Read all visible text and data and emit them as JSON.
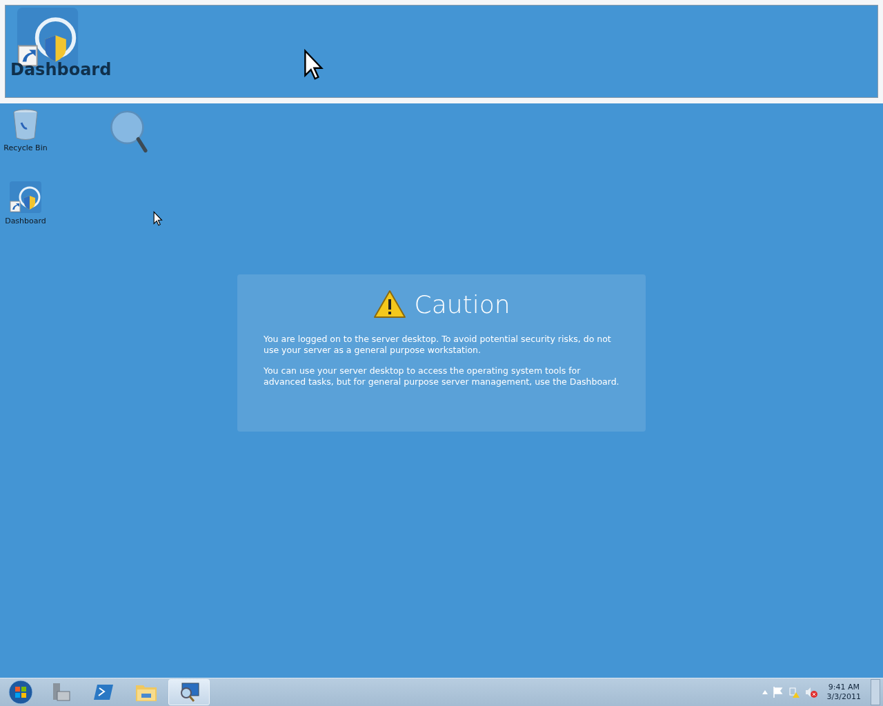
{
  "magnifier_view": {
    "icon_label": "Dashboard"
  },
  "desktop_icons": [
    {
      "kind": "recycle",
      "label": "Recycle Bin"
    },
    {
      "kind": "magnifier"
    },
    {
      "kind": "dashboard",
      "label": "Dashboard"
    }
  ],
  "caution": {
    "title": "Caution",
    "paragraphs": [
      "You are logged on to the server desktop. To avoid potential security risks, do not use your server as a general purpose workstation.",
      "You can use your server desktop to access the operating system tools for advanced tasks, but for general purpose server management, use the Dashboard."
    ]
  },
  "taskbar": {
    "items": [
      {
        "kind": "server-manager",
        "selected": false
      },
      {
        "kind": "powershell",
        "selected": false
      },
      {
        "kind": "explorer",
        "selected": false
      },
      {
        "kind": "magnifier",
        "selected": true
      }
    ],
    "clock_time": "9:41 AM",
    "clock_date": "3/3/2011"
  }
}
